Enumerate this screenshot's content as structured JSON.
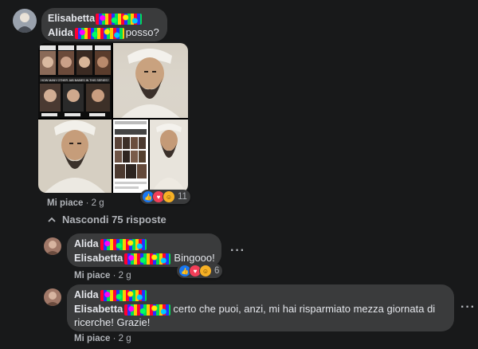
{
  "comment": {
    "author": "Elisabetta",
    "mention": "Alida",
    "text": "posso?",
    "like_label": "Mi piace",
    "time": "2 g",
    "reaction_count": "11",
    "reactions": [
      "like-icon",
      "love-icon",
      "haha-icon"
    ]
  },
  "collage": {
    "panel_labels": [
      "AMI",
      "AYAN",
      "HUMA",
      "KAMALA"
    ],
    "panel_caption": "HOW MANY OTHER JAB BABIES IN THIS SERIES?",
    "panel_labels_bottom": [
      "JOUMANA",
      "NESRIN",
      "RIMA"
    ]
  },
  "replies_toggle": {
    "label": "Nascondi 75 risposte"
  },
  "replies": [
    {
      "author": "Alida",
      "mention": "Elisabetta",
      "text": "Bingooo!",
      "like_label": "Mi piace",
      "time": "2 g",
      "reaction_count": "6"
    },
    {
      "author": "Alida",
      "mention": "Elisabetta",
      "text": "certo che puoi, anzi, mi hai risparmiato mezza giornata di ricerche! Grazie!",
      "like_label": "Mi piace",
      "time": "2 g"
    }
  ],
  "colors": {
    "background": "#18191a",
    "bubble": "#3a3b3c",
    "text": "#e4e6eb",
    "secondary": "#b0b3b8"
  }
}
